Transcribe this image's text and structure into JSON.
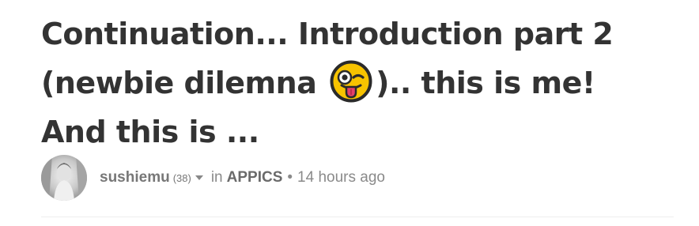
{
  "post": {
    "title_part1": "Continuation... Introduction part 2 (newbie dilemna",
    "title_emoji": "winking-face-with-tongue-icon",
    "title_part2": ").. this is me! And this is ..."
  },
  "meta": {
    "avatar": "user-avatar",
    "author": "sushiemu",
    "reputation": "(38)",
    "in_label": "in",
    "community": "APPICS",
    "separator": "•",
    "time_ago": "14 hours ago"
  },
  "colors": {
    "title": "#333333",
    "meta_text": "#8a8a8a",
    "emoji_face": "#F7C300",
    "emoji_outline": "#2A2A2A",
    "tongue": "#E5406A",
    "divider": "#eeeeee"
  }
}
